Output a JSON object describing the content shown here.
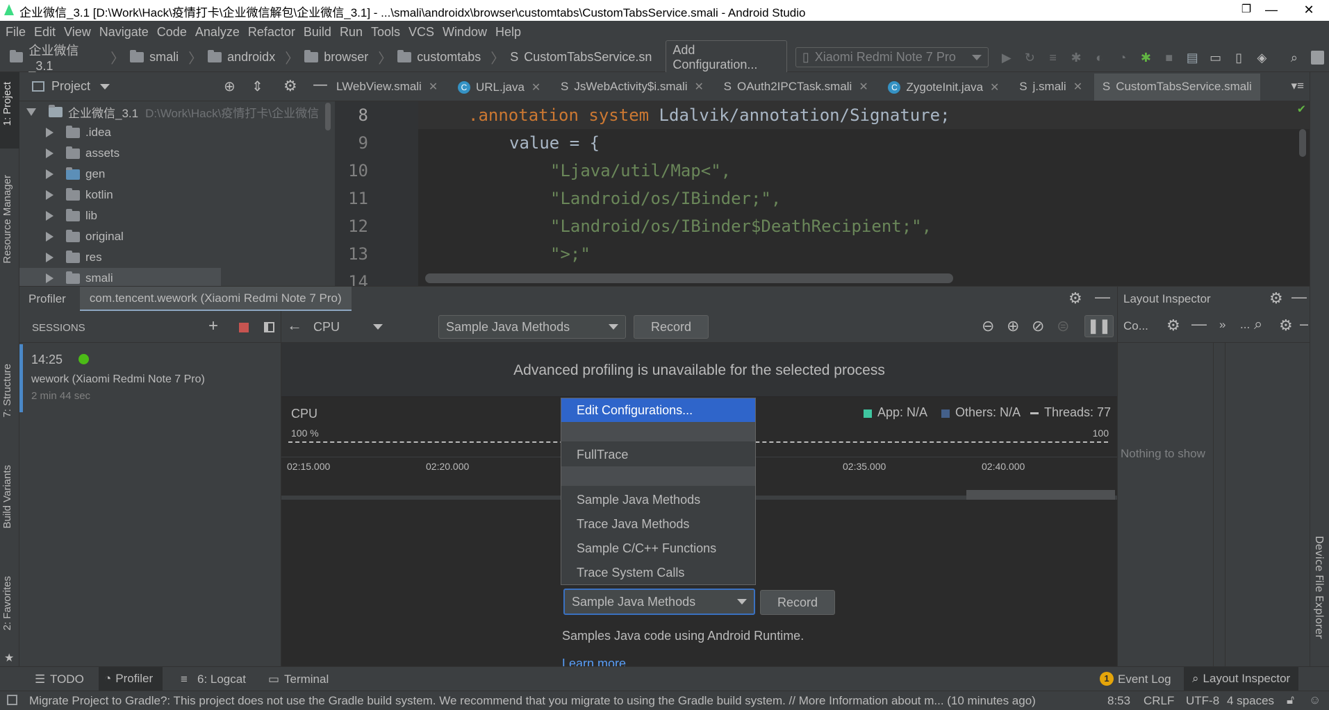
{
  "window": {
    "title": "企业微信_3.1 [D:\\Work\\Hack\\疫情打卡\\企业微信解包\\企业微信_3.1] - ...\\smali\\androidx\\browser\\customtabs\\CustomTabsService.smali - Android Studio",
    "minimize": "—",
    "restore": "❐",
    "close": "✕"
  },
  "menu": [
    "File",
    "Edit",
    "View",
    "Navigate",
    "Code",
    "Analyze",
    "Refactor",
    "Build",
    "Run",
    "Tools",
    "VCS",
    "Window",
    "Help"
  ],
  "breadcrumbs": [
    "企业微信_3.1",
    "smali",
    "androidx",
    "browser",
    "customtabs",
    "CustomTabsService.sn"
  ],
  "toolbar": {
    "add_config": "Add Configuration...",
    "device": "Xiaomi Redmi Note 7 Pro"
  },
  "left_tabs": {
    "project": "1: Project",
    "resource_manager": "Resource Manager",
    "structure": "7: Structure",
    "build_variants": "Build Variants",
    "favorites": "2: Favorites"
  },
  "right_tabs": {
    "device_file_explorer": "Device File Explorer"
  },
  "project_panel": {
    "title": "Project",
    "root_name": "企业微信_3.1",
    "root_path": "D:\\Work\\Hack\\疫情打卡\\企业微信",
    "items": [
      ".idea",
      "assets",
      "gen",
      "kotlin",
      "lib",
      "original",
      "res",
      "smali"
    ]
  },
  "editor": {
    "tabs": [
      {
        "name": "LWebView.smali",
        "icon": "S",
        "active": false
      },
      {
        "name": "URL.java",
        "icon": "C",
        "active": false
      },
      {
        "name": "JsWebActivity$i.smali",
        "icon": "S",
        "active": false
      },
      {
        "name": "OAuth2IPCTask.smali",
        "icon": "S",
        "active": false
      },
      {
        "name": "ZygoteInit.java",
        "icon": "C",
        "active": false
      },
      {
        "name": "j.smali",
        "icon": "S",
        "active": false
      },
      {
        "name": "CustomTabsService.smali",
        "icon": "S",
        "active": true
      }
    ],
    "line_numbers": [
      "8",
      "9",
      "10",
      "11",
      "12",
      "13",
      "14"
    ],
    "code": {
      "l8_kw": ".annotation system",
      "l8_rest": " Ldalvik/annotation/Signature;",
      "l9": "value = {",
      "l10": "\"Ljava/util/Map<\",",
      "l11": "\"Landroid/os/IBinder;\",",
      "l12": "\"Landroid/os/IBinder$DeathRecipient;\",",
      "l13": "\">;\""
    }
  },
  "profiler": {
    "tab_label": "Profiler",
    "process_tab": "com.tencent.wework (Xiaomi Redmi Note 7 Pro)",
    "sessions_label": "SESSIONS",
    "session": {
      "time": "14:25",
      "name": "wework (Xiaomi Redmi Note 7 Pro)",
      "duration": "2 min 44 sec"
    },
    "monitor": "CPU",
    "config_selected": "Sample Java Methods",
    "record": "Record",
    "banner": "Advanced profiling is unavailable for the selected process",
    "cpu_label": "CPU",
    "percent_left": "100 %",
    "percent_right": "100",
    "legend_app": "App: N/A",
    "legend_others": "Others: N/A",
    "legend_threads": "Threads: 77",
    "ticks": [
      "02:15.000",
      "02:20.000",
      "02:35.000",
      "02:40.000"
    ],
    "dropdown": {
      "edit": "Edit Configurations...",
      "fulltrace": "FullTrace",
      "items": [
        "Sample Java Methods",
        "Trace Java Methods",
        "Sample C/C++ Functions",
        "Trace System Calls"
      ]
    },
    "config_description": "Samples Java code using Android Runtime.",
    "learn_more": "Learn more"
  },
  "layout_inspector": {
    "title": "Layout Inspector",
    "col_short": "Co...",
    "more": "...",
    "nothing": "Nothing to show"
  },
  "bottom_tabs": {
    "todo": "TODO",
    "profiler": "Profiler",
    "logcat": "6: Logcat",
    "terminal": "Terminal",
    "event_log_count": "1",
    "event_log": "Event Log",
    "layout_inspector": "Layout Inspector"
  },
  "status": {
    "message": "Migrate Project to Gradle?: This project does not use the Gradle build system. We recommend that you migrate to using the Gradle build system. // More Information about m... (10 minutes ago)",
    "position": "8:53",
    "line_sep": "CRLF",
    "encoding": "UTF-8",
    "indent": "4 spaces"
  },
  "colors": {
    "accent": "#2f65ca",
    "app_legend": "#3fc6a0",
    "others_legend": "#44608a",
    "session_dot": "#4cbb17"
  }
}
